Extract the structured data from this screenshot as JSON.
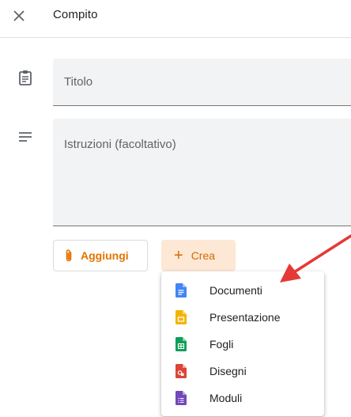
{
  "header": {
    "title": "Compito",
    "close_icon": "close-icon"
  },
  "form": {
    "title_placeholder": "Titolo",
    "instructions_placeholder": "Istruzioni (facoltativo)",
    "title_icon": "clipboard-icon",
    "instructions_icon": "notes-icon"
  },
  "buttons": {
    "add_label": "Aggiungi",
    "add_icon": "paperclip-icon",
    "create_label": "Crea",
    "create_icon": "plus-icon"
  },
  "create_menu": {
    "items": [
      {
        "label": "Documenti",
        "icon": "docs-icon",
        "color": "#4285f4"
      },
      {
        "label": "Presentazione",
        "icon": "slides-icon",
        "color": "#f4b400"
      },
      {
        "label": "Fogli",
        "icon": "sheets-icon",
        "color": "#0f9d58"
      },
      {
        "label": "Disegni",
        "icon": "drawings-icon",
        "color": "#db4437"
      },
      {
        "label": "Moduli",
        "icon": "forms-icon",
        "color": "#7248b9"
      }
    ]
  },
  "colors": {
    "accent_orange": "#d86a00",
    "create_bg": "#fce8d4",
    "annotation_arrow": "#e53935"
  }
}
